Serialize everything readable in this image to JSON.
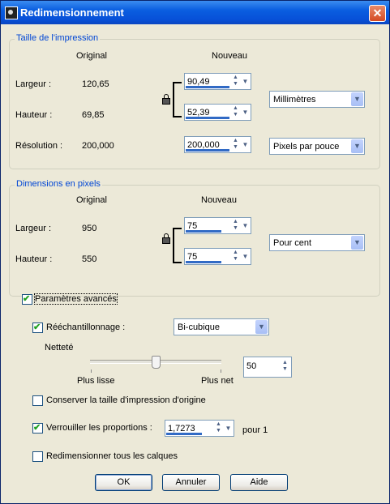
{
  "window": {
    "title": "Redimensionnement",
    "close_glyph": "✕"
  },
  "print_size": {
    "group_title": "Taille de l'impression",
    "col_original": "Original",
    "col_nouveau": "Nouveau",
    "width_label": "Largeur :",
    "width_original": "120,65",
    "width_new": "90,49",
    "height_label": "Hauteur :",
    "height_original": "69,85",
    "height_new": "52,39",
    "unit": "Millimètres",
    "resolution_label": "Résolution :",
    "resolution_original": "200,000",
    "resolution_new": "200,000",
    "resolution_unit": "Pixels par pouce"
  },
  "pixel_dims": {
    "group_title": "Dimensions en pixels",
    "col_original": "Original",
    "col_nouveau": "Nouveau",
    "width_label": "Largeur :",
    "width_original": "950",
    "width_new": "75",
    "height_label": "Hauteur :",
    "height_original": "550",
    "height_new": "75",
    "unit": "Pour cent"
  },
  "advanced": {
    "label": "Paramètres avancés",
    "checked": true,
    "resample_label": "Rééchantillonnage :",
    "resample_checked": true,
    "resample_method": "Bi-cubique",
    "sharpness_label": "Netteté",
    "slider_min_label": "Plus lisse",
    "slider_max_label": "Plus net",
    "sharpness_value": "50",
    "keep_print_size_label": "Conserver la taille d'impression d'origine",
    "keep_print_size_checked": false,
    "lock_ratio_label": "Verrouiller les proportions :",
    "lock_ratio_checked": true,
    "ratio_value": "1,7273",
    "ratio_suffix": "pour 1",
    "resize_layers_label": "Redimensionner tous les calques",
    "resize_layers_checked": false
  },
  "buttons": {
    "ok": "OK",
    "cancel": "Annuler",
    "help": "Aide"
  },
  "icons": {
    "spin_up": "▲",
    "spin_down": "▼",
    "dropdown": "▼"
  },
  "colors": {
    "titlebar": "#0a5ee0",
    "group_title": "#0046d5",
    "face": "#ece9d8"
  }
}
